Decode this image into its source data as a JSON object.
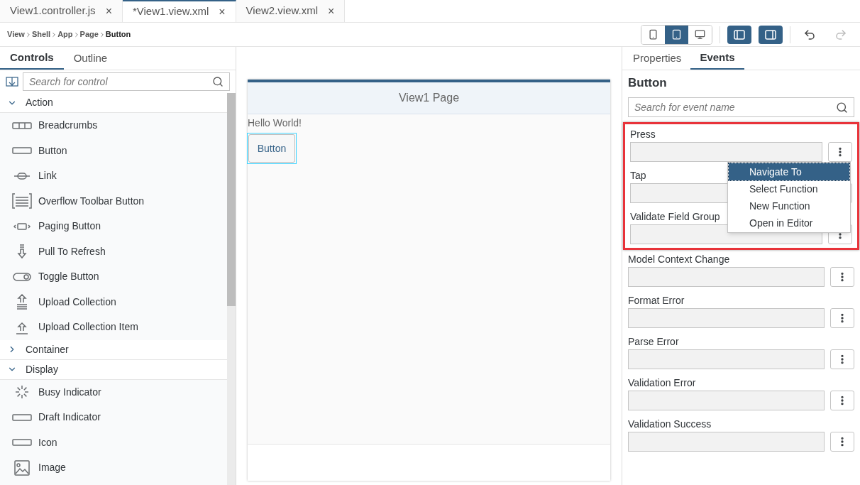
{
  "file_tabs": [
    {
      "label": "View1.controller.js",
      "close": "×",
      "selected": false
    },
    {
      "label": "*View1.view.xml",
      "close": "×",
      "selected": true
    },
    {
      "label": "View2.view.xml",
      "close": "×",
      "selected": false
    }
  ],
  "breadcrumb": [
    {
      "label": "View",
      "current": false
    },
    {
      "label": "Shell",
      "current": false
    },
    {
      "label": "App",
      "current": false
    },
    {
      "label": "Page",
      "current": false
    },
    {
      "label": "Button",
      "current": true
    }
  ],
  "toolbar": {
    "devices": [
      {
        "kind": "phone",
        "selected": false
      },
      {
        "kind": "tablet",
        "selected": true
      },
      {
        "kind": "desktop",
        "selected": false
      }
    ],
    "panels": [
      {
        "kind": "left",
        "on": true
      },
      {
        "kind": "right",
        "on": true
      }
    ],
    "undo": {
      "disabled": false
    },
    "redo": {
      "disabled": true
    }
  },
  "left_panel": {
    "tabs": [
      {
        "label": "Controls",
        "selected": true
      },
      {
        "label": "Outline",
        "selected": false
      }
    ],
    "search": {
      "placeholder": "Search for control"
    },
    "groups": [
      {
        "label": "Action",
        "expanded": true,
        "items": [
          {
            "label": "Breadcrumbs",
            "kind": "breadcrumbs"
          },
          {
            "label": "Button",
            "kind": "button"
          },
          {
            "label": "Link",
            "kind": "link"
          },
          {
            "label": "Overflow Toolbar Button",
            "kind": "overflow"
          },
          {
            "label": "Paging Button",
            "kind": "paging"
          },
          {
            "label": "Pull To Refresh",
            "kind": "pull"
          },
          {
            "label": "Toggle Button",
            "kind": "toggle"
          },
          {
            "label": "Upload Collection",
            "kind": "upload"
          },
          {
            "label": "Upload Collection Item",
            "kind": "upload-item"
          }
        ]
      },
      {
        "label": "Container",
        "expanded": false
      },
      {
        "label": "Display",
        "expanded": true,
        "items": [
          {
            "label": "Busy Indicator",
            "kind": "busy"
          },
          {
            "label": "Draft Indicator",
            "kind": "button"
          },
          {
            "label": "Icon",
            "kind": "button"
          },
          {
            "label": "Image",
            "kind": "image"
          }
        ]
      }
    ]
  },
  "canvas": {
    "page_title": "View1 Page",
    "text": "Hello World!",
    "button": {
      "label": "Button",
      "selected": true
    }
  },
  "right_panel": {
    "tabs": [
      {
        "label": "Properties",
        "selected": false
      },
      {
        "label": "Events",
        "selected": true
      }
    ],
    "heading": "Button",
    "search": {
      "placeholder": "Search for event name"
    },
    "events": [
      {
        "label": "Press",
        "highlighted": true,
        "menu": [
          {
            "label": "Navigate To",
            "selected": true
          },
          {
            "label": "Select Function",
            "selected": false
          },
          {
            "label": "New Function",
            "selected": false
          },
          {
            "label": "Open in Editor",
            "selected": false
          }
        ]
      },
      {
        "label": "Tap",
        "highlighted": true
      },
      {
        "label": "Validate Field Group",
        "highlighted": true
      },
      {
        "label": "Model Context Change",
        "highlighted": false
      },
      {
        "label": "Format Error",
        "highlighted": false
      },
      {
        "label": "Parse Error",
        "highlighted": false
      },
      {
        "label": "Validation Error",
        "highlighted": false
      },
      {
        "label": "Validation Success",
        "highlighted": false
      }
    ]
  }
}
